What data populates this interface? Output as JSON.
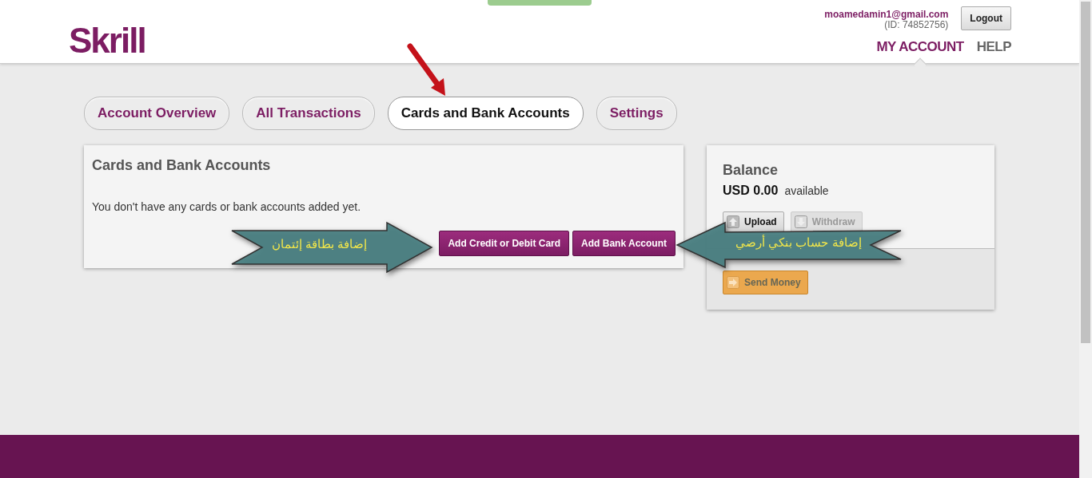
{
  "header": {
    "logo": "Skrill",
    "email": "moamedamin1@gmail.com",
    "account_id": "(ID: 74852756)",
    "logout": "Logout",
    "nav": [
      {
        "label": "MY ACCOUNT",
        "selected": true
      },
      {
        "label": "HELP",
        "selected": false
      }
    ]
  },
  "tabs": [
    {
      "label": "Account Overview",
      "selected": false
    },
    {
      "label": "All Transactions",
      "selected": false
    },
    {
      "label": "Cards and Bank Accounts",
      "selected": true
    },
    {
      "label": "Settings",
      "selected": false
    }
  ],
  "cards_panel": {
    "title": "Cards and Bank Accounts",
    "message": "You don't have any cards or bank accounts added yet.",
    "buttons": [
      "Add Credit or Debit Card",
      "Add Bank Account"
    ]
  },
  "balance": {
    "title": "Balance",
    "amount": "USD 0.00",
    "amount_note": "available",
    "actions": [
      {
        "label": "Upload",
        "disabled": false
      },
      {
        "label": "Withdraw",
        "disabled": true
      }
    ],
    "send_money": "Send Money"
  },
  "annotations": [
    {
      "text": "إضافة حساب بنكي أرضي",
      "kind": "left-arrow"
    },
    {
      "text": "إضافة بطاقة إئتمان",
      "kind": "right-arrow"
    }
  ]
}
